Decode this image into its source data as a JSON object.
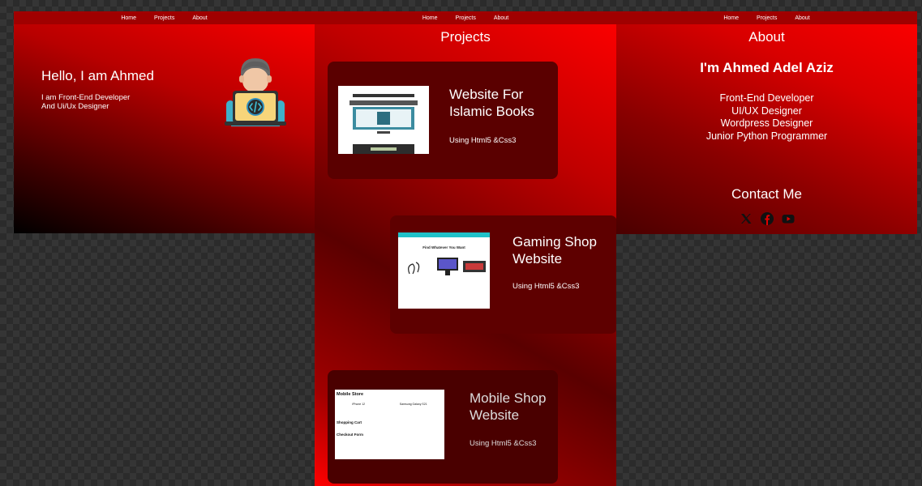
{
  "nav": {
    "home": "Home",
    "projects": "Projects",
    "about": "About"
  },
  "hero": {
    "greeting": "Hello, I am Ahmed",
    "line1": "I am Front-End Developer",
    "line2": "And Ui/Ux Designer"
  },
  "projects": {
    "title": "Projects",
    "items": [
      {
        "title_line1": "Website For",
        "title_line2": "Islamic Books",
        "tech": "Using Html5 &Css3"
      },
      {
        "title_line1": "Gaming Shop",
        "title_line2": "Website",
        "tech": "Using Html5 &Css3"
      },
      {
        "title_line1": "Mobile Shop",
        "title_line2": "Website",
        "tech": "Using Html5 &Css3"
      }
    ]
  },
  "about": {
    "title": "About",
    "name": "I'm Ahmed Adel Aziz",
    "roles": [
      "Front-End Developer",
      "UI/UX Designer",
      "Wordpress Designer",
      "Junior Python Programmer"
    ],
    "contact_title": "Contact Me"
  },
  "thumbs": {
    "gaming_heading": "Find Whatever You Want",
    "mobile": {
      "title": "Mobile Store",
      "product1": "iPhone 12",
      "product2": "Samsung Galaxy S21",
      "cart": "Shopping Cart",
      "checkout": "Checkout Form"
    }
  },
  "icons": {
    "socials": [
      "x-icon",
      "facebook-icon",
      "youtube-icon"
    ]
  },
  "colors": {
    "accent": "#ff0000",
    "dark_red": "#5a0000",
    "nav": "#a00000"
  }
}
